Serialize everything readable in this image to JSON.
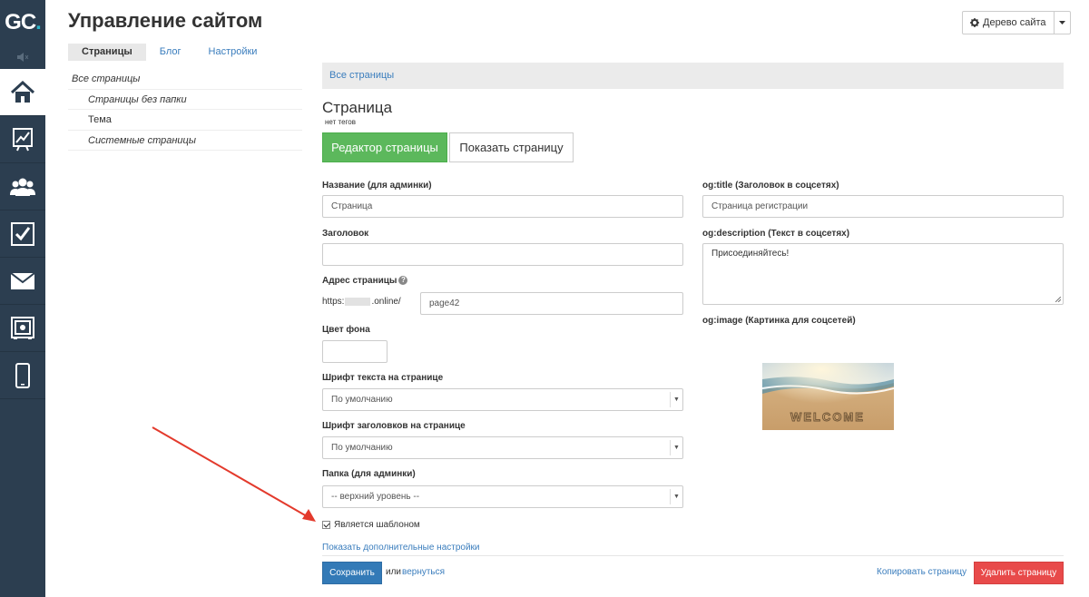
{
  "logo": {
    "text": "GC",
    "dot": "."
  },
  "header": {
    "title": "Управление сайтом",
    "tabs": [
      "Страницы",
      "Блог",
      "Настройки"
    ],
    "site_tree_label": "Дерево сайта"
  },
  "subnav": {
    "items": [
      "Все страницы",
      "Страницы без папки",
      "Тема",
      "Системные страницы"
    ]
  },
  "breadcrumb": "Все страницы",
  "page": {
    "title": "Страница",
    "tags_note": "нет тегов",
    "editor_button": "Редактор страницы",
    "show_button": "Показать страницу"
  },
  "form": {
    "name_label": "Название (для админки)",
    "name_value": "Страница",
    "heading_label": "Заголовок",
    "heading_value": "",
    "address_label": "Адрес страницы",
    "address_prefix_start": "https:",
    "address_prefix_end": ".online/",
    "address_value": "page42",
    "bg_color_label": "Цвет фона",
    "bg_color_value": "",
    "text_font_label": "Шрифт текста на странице",
    "text_font_value": "По умолчанию",
    "heading_font_label": "Шрифт заголовков на странице",
    "heading_font_value": "По умолчанию",
    "folder_label": "Папка (для админки)",
    "folder_value": "-- верхний уровень --",
    "template_checkbox_label": "Является шаблоном",
    "template_checked": true,
    "more_settings_link": "Показать дополнительные настройки"
  },
  "og": {
    "title_label": "og:title (Заголовок в соцсетях)",
    "title_value": "Страница регистрации",
    "description_label": "og:description (Текст в соцсетях)",
    "description_value": "Присоединяйтесь!",
    "image_label": "og:image (Картинка для соцсетей)",
    "image_text": "WELCOME"
  },
  "footer": {
    "save_button": "Сохранить",
    "or_text": "или",
    "back_link": "вернуться",
    "copy_link": "Копировать страницу",
    "delete_button": "Удалить страницу"
  },
  "colors": {
    "rail": "#2c3e50",
    "accent_green": "#5cb85c",
    "accent_blue": "#337ab7",
    "danger_red": "#e84a4a",
    "annotation_red": "#e33a2c"
  },
  "rail_icons": [
    "home-icon",
    "chart-icon",
    "users-icon",
    "tasks-icon",
    "mail-icon",
    "safe-icon",
    "mobile-icon"
  ]
}
